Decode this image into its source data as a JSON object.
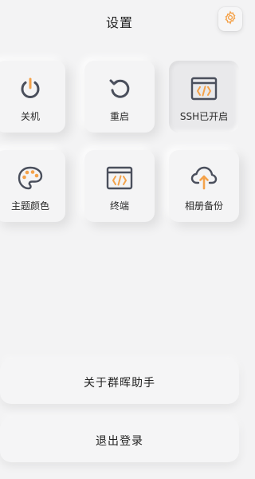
{
  "header": {
    "title": "设置",
    "settings_icon": "gear-icon"
  },
  "tiles": [
    {
      "label": "关机",
      "icon": "power-icon",
      "active": false
    },
    {
      "label": "重启",
      "icon": "restart-icon",
      "active": false
    },
    {
      "label": "SSH已开启",
      "icon": "code-window-icon",
      "active": true
    },
    {
      "label": "主题颜色",
      "icon": "palette-icon",
      "active": false
    },
    {
      "label": "终端",
      "icon": "terminal-code-icon",
      "active": false
    },
    {
      "label": "相册备份",
      "icon": "cloud-upload-icon",
      "active": false
    }
  ],
  "actions": {
    "about_label": "关于群晖助手",
    "logout_label": "退出登录"
  },
  "colors": {
    "icon_dark": "#4a4f5c",
    "accent": "#f4a24a",
    "background": "#f3f3f4"
  }
}
